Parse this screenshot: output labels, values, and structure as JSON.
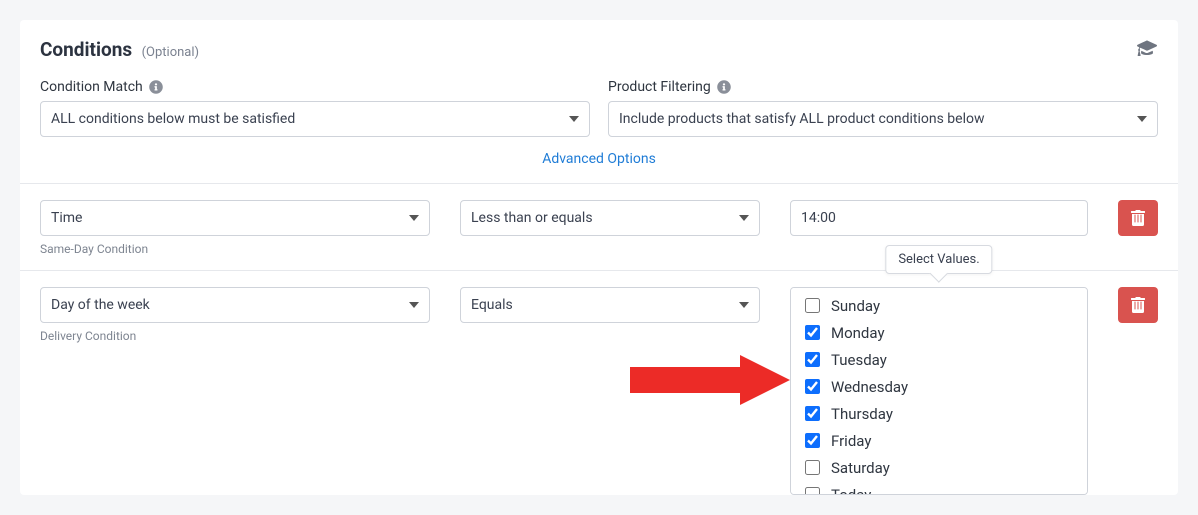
{
  "header": {
    "title": "Conditions",
    "optional": "(Optional)"
  },
  "top": {
    "match_label": "Condition Match",
    "match_value": "ALL conditions below must be satisfied",
    "filter_label": "Product Filtering",
    "filter_value": "Include products that satisfy ALL product conditions below"
  },
  "advanced_link": "Advanced Options",
  "rows": [
    {
      "field": "Time",
      "operator": "Less than or equals",
      "value": "14:00",
      "caption": "Same-Day Condition"
    },
    {
      "field": "Day of the week",
      "operator": "Equals",
      "caption": "Delivery Condition",
      "tooltip": "Select Values.",
      "options": [
        {
          "label": "Sunday",
          "checked": false
        },
        {
          "label": "Monday",
          "checked": true
        },
        {
          "label": "Tuesday",
          "checked": true
        },
        {
          "label": "Wednesday",
          "checked": true
        },
        {
          "label": "Thursday",
          "checked": true
        },
        {
          "label": "Friday",
          "checked": true
        },
        {
          "label": "Saturday",
          "checked": false
        },
        {
          "label": "Today",
          "checked": false
        }
      ]
    }
  ]
}
